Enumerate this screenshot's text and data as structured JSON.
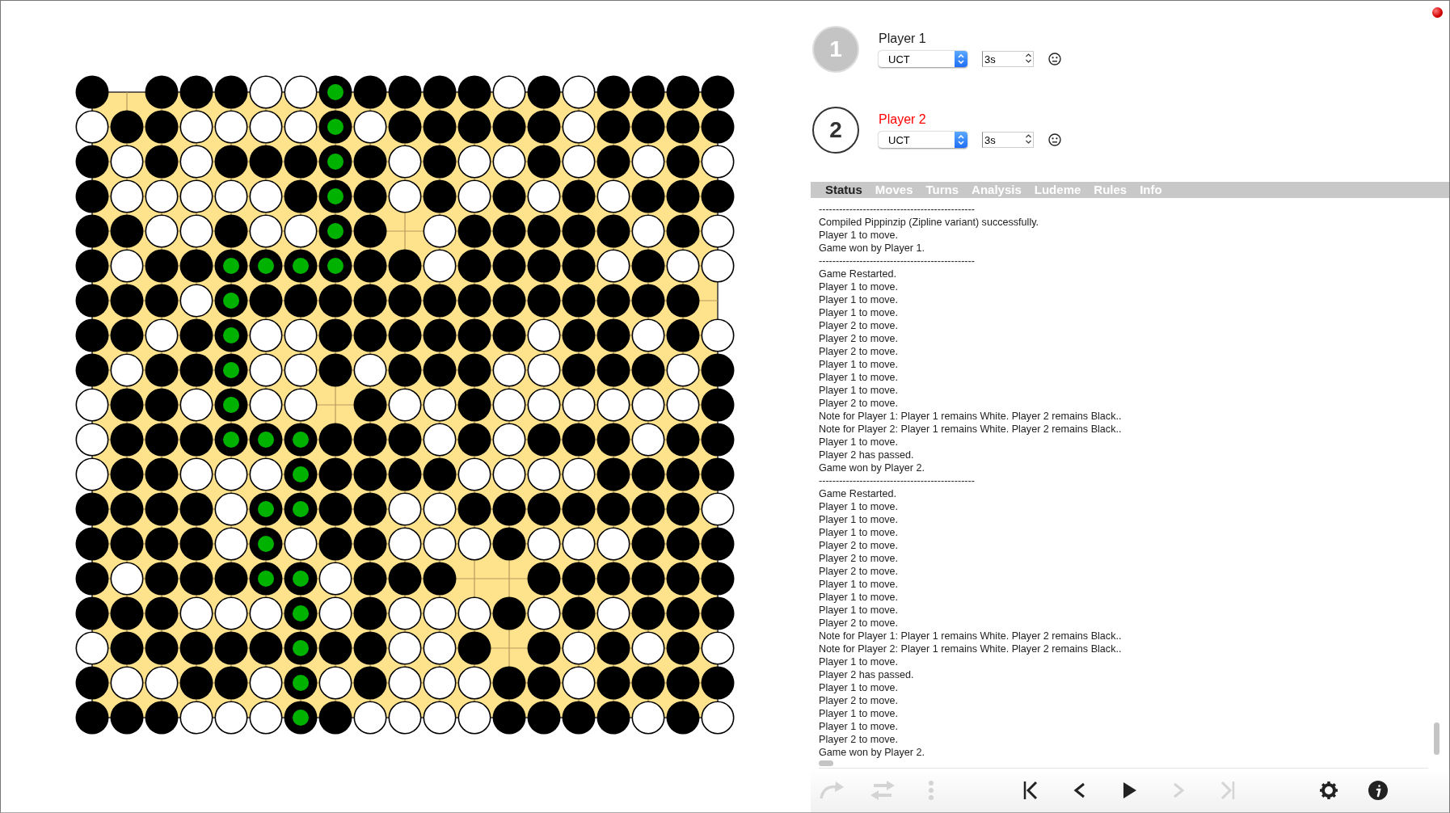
{
  "board": {
    "rows": [
      [
        {
          "kind": "black"
        },
        {
          "kind": "empty"
        },
        {
          "kind": "black"
        },
        {
          "kind": "black"
        },
        {
          "kind": "black"
        },
        {
          "kind": "white"
        },
        {
          "kind": "white"
        },
        {
          "kind": "marked"
        },
        {
          "kind": "black"
        },
        {
          "kind": "black"
        },
        {
          "kind": "black"
        },
        {
          "kind": "black"
        },
        {
          "kind": "white"
        },
        {
          "kind": "black"
        },
        {
          "kind": "white"
        },
        {
          "kind": "black"
        },
        {
          "kind": "black"
        },
        {
          "kind": "black"
        },
        {
          "kind": "black"
        }
      ],
      [
        {
          "kind": "white"
        },
        {
          "kind": "black"
        },
        {
          "kind": "black"
        },
        {
          "kind": "white"
        },
        {
          "kind": "white"
        },
        {
          "kind": "white"
        },
        {
          "kind": "white"
        },
        {
          "kind": "marked"
        },
        {
          "kind": "white"
        },
        {
          "kind": "black"
        },
        {
          "kind": "black"
        },
        {
          "kind": "black"
        },
        {
          "kind": "black"
        },
        {
          "kind": "black"
        },
        {
          "kind": "white"
        },
        {
          "kind": "black"
        },
        {
          "kind": "black"
        },
        {
          "kind": "black"
        },
        {
          "kind": "black"
        }
      ],
      [
        {
          "kind": "black"
        },
        {
          "kind": "white"
        },
        {
          "kind": "black"
        },
        {
          "kind": "white"
        },
        {
          "kind": "black"
        },
        {
          "kind": "black"
        },
        {
          "kind": "black"
        },
        {
          "kind": "marked"
        },
        {
          "kind": "black"
        },
        {
          "kind": "white"
        },
        {
          "kind": "black"
        },
        {
          "kind": "white"
        },
        {
          "kind": "white"
        },
        {
          "kind": "black"
        },
        {
          "kind": "white"
        },
        {
          "kind": "black"
        },
        {
          "kind": "white"
        },
        {
          "kind": "black"
        },
        {
          "kind": "white"
        }
      ],
      [
        {
          "kind": "black"
        },
        {
          "kind": "white"
        },
        {
          "kind": "white"
        },
        {
          "kind": "white"
        },
        {
          "kind": "white"
        },
        {
          "kind": "white"
        },
        {
          "kind": "black"
        },
        {
          "kind": "marked"
        },
        {
          "kind": "black"
        },
        {
          "kind": "white"
        },
        {
          "kind": "black"
        },
        {
          "kind": "white"
        },
        {
          "kind": "black"
        },
        {
          "kind": "white"
        },
        {
          "kind": "black"
        },
        {
          "kind": "white"
        },
        {
          "kind": "black"
        },
        {
          "kind": "black"
        },
        {
          "kind": "black"
        }
      ],
      [
        {
          "kind": "black"
        },
        {
          "kind": "black"
        },
        {
          "kind": "white"
        },
        {
          "kind": "white"
        },
        {
          "kind": "black"
        },
        {
          "kind": "white"
        },
        {
          "kind": "white"
        },
        {
          "kind": "marked"
        },
        {
          "kind": "black"
        },
        {
          "kind": "empty"
        },
        {
          "kind": "white"
        },
        {
          "kind": "black"
        },
        {
          "kind": "black"
        },
        {
          "kind": "black"
        },
        {
          "kind": "black"
        },
        {
          "kind": "black"
        },
        {
          "kind": "white"
        },
        {
          "kind": "black"
        },
        {
          "kind": "white"
        }
      ],
      [
        {
          "kind": "black"
        },
        {
          "kind": "white"
        },
        {
          "kind": "black"
        },
        {
          "kind": "black"
        },
        {
          "kind": "marked"
        },
        {
          "kind": "marked"
        },
        {
          "kind": "marked"
        },
        {
          "kind": "marked"
        },
        {
          "kind": "black"
        },
        {
          "kind": "black"
        },
        {
          "kind": "white"
        },
        {
          "kind": "black"
        },
        {
          "kind": "black"
        },
        {
          "kind": "black"
        },
        {
          "kind": "black"
        },
        {
          "kind": "white"
        },
        {
          "kind": "black"
        },
        {
          "kind": "white"
        },
        {
          "kind": "white"
        }
      ],
      [
        {
          "kind": "black"
        },
        {
          "kind": "black"
        },
        {
          "kind": "black"
        },
        {
          "kind": "white"
        },
        {
          "kind": "marked"
        },
        {
          "kind": "black"
        },
        {
          "kind": "black"
        },
        {
          "kind": "black"
        },
        {
          "kind": "black"
        },
        {
          "kind": "black"
        },
        {
          "kind": "black"
        },
        {
          "kind": "black"
        },
        {
          "kind": "black"
        },
        {
          "kind": "black"
        },
        {
          "kind": "black"
        },
        {
          "kind": "black"
        },
        {
          "kind": "black"
        },
        {
          "kind": "black"
        },
        {
          "kind": "empty"
        }
      ],
      [
        {
          "kind": "black"
        },
        {
          "kind": "black"
        },
        {
          "kind": "white"
        },
        {
          "kind": "black"
        },
        {
          "kind": "marked"
        },
        {
          "kind": "white"
        },
        {
          "kind": "white"
        },
        {
          "kind": "black"
        },
        {
          "kind": "black"
        },
        {
          "kind": "black"
        },
        {
          "kind": "black"
        },
        {
          "kind": "black"
        },
        {
          "kind": "black"
        },
        {
          "kind": "white"
        },
        {
          "kind": "black"
        },
        {
          "kind": "black"
        },
        {
          "kind": "white"
        },
        {
          "kind": "black"
        },
        {
          "kind": "white"
        }
      ],
      [
        {
          "kind": "black"
        },
        {
          "kind": "white"
        },
        {
          "kind": "black"
        },
        {
          "kind": "black"
        },
        {
          "kind": "marked"
        },
        {
          "kind": "white"
        },
        {
          "kind": "white"
        },
        {
          "kind": "black"
        },
        {
          "kind": "white"
        },
        {
          "kind": "black"
        },
        {
          "kind": "black"
        },
        {
          "kind": "black"
        },
        {
          "kind": "white"
        },
        {
          "kind": "white"
        },
        {
          "kind": "black"
        },
        {
          "kind": "black"
        },
        {
          "kind": "black"
        },
        {
          "kind": "white"
        },
        {
          "kind": "black"
        }
      ],
      [
        {
          "kind": "white"
        },
        {
          "kind": "black"
        },
        {
          "kind": "black"
        },
        {
          "kind": "white"
        },
        {
          "kind": "marked"
        },
        {
          "kind": "white"
        },
        {
          "kind": "white"
        },
        {
          "kind": "empty"
        },
        {
          "kind": "black"
        },
        {
          "kind": "white"
        },
        {
          "kind": "white"
        },
        {
          "kind": "black"
        },
        {
          "kind": "white"
        },
        {
          "kind": "white"
        },
        {
          "kind": "white"
        },
        {
          "kind": "white"
        },
        {
          "kind": "white"
        },
        {
          "kind": "white"
        },
        {
          "kind": "black"
        }
      ],
      [
        {
          "kind": "white"
        },
        {
          "kind": "black"
        },
        {
          "kind": "black"
        },
        {
          "kind": "black"
        },
        {
          "kind": "marked"
        },
        {
          "kind": "marked"
        },
        {
          "kind": "marked"
        },
        {
          "kind": "black"
        },
        {
          "kind": "black"
        },
        {
          "kind": "black"
        },
        {
          "kind": "white"
        },
        {
          "kind": "black"
        },
        {
          "kind": "white"
        },
        {
          "kind": "black"
        },
        {
          "kind": "black"
        },
        {
          "kind": "black"
        },
        {
          "kind": "white"
        },
        {
          "kind": "black"
        },
        {
          "kind": "black"
        }
      ],
      [
        {
          "kind": "white"
        },
        {
          "kind": "black"
        },
        {
          "kind": "black"
        },
        {
          "kind": "white"
        },
        {
          "kind": "white"
        },
        {
          "kind": "white"
        },
        {
          "kind": "marked"
        },
        {
          "kind": "black"
        },
        {
          "kind": "black"
        },
        {
          "kind": "black"
        },
        {
          "kind": "black"
        },
        {
          "kind": "white"
        },
        {
          "kind": "white"
        },
        {
          "kind": "white"
        },
        {
          "kind": "white"
        },
        {
          "kind": "black"
        },
        {
          "kind": "black"
        },
        {
          "kind": "black"
        },
        {
          "kind": "black"
        }
      ],
      [
        {
          "kind": "black"
        },
        {
          "kind": "black"
        },
        {
          "kind": "black"
        },
        {
          "kind": "black"
        },
        {
          "kind": "white"
        },
        {
          "kind": "marked"
        },
        {
          "kind": "marked"
        },
        {
          "kind": "black"
        },
        {
          "kind": "black"
        },
        {
          "kind": "white"
        },
        {
          "kind": "white"
        },
        {
          "kind": "black"
        },
        {
          "kind": "black"
        },
        {
          "kind": "black"
        },
        {
          "kind": "black"
        },
        {
          "kind": "black"
        },
        {
          "kind": "black"
        },
        {
          "kind": "black"
        },
        {
          "kind": "white"
        }
      ],
      [
        {
          "kind": "black"
        },
        {
          "kind": "black"
        },
        {
          "kind": "black"
        },
        {
          "kind": "black"
        },
        {
          "kind": "white"
        },
        {
          "kind": "marked"
        },
        {
          "kind": "white"
        },
        {
          "kind": "black"
        },
        {
          "kind": "black"
        },
        {
          "kind": "white"
        },
        {
          "kind": "white"
        },
        {
          "kind": "white"
        },
        {
          "kind": "black"
        },
        {
          "kind": "white"
        },
        {
          "kind": "white"
        },
        {
          "kind": "white"
        },
        {
          "kind": "black"
        },
        {
          "kind": "black"
        },
        {
          "kind": "black"
        }
      ],
      [
        {
          "kind": "black"
        },
        {
          "kind": "white"
        },
        {
          "kind": "black"
        },
        {
          "kind": "black"
        },
        {
          "kind": "black"
        },
        {
          "kind": "marked"
        },
        {
          "kind": "marked"
        },
        {
          "kind": "white"
        },
        {
          "kind": "black"
        },
        {
          "kind": "black"
        },
        {
          "kind": "black"
        },
        {
          "kind": "empty"
        },
        {
          "kind": "empty"
        },
        {
          "kind": "black"
        },
        {
          "kind": "black"
        },
        {
          "kind": "black"
        },
        {
          "kind": "black"
        },
        {
          "kind": "black"
        },
        {
          "kind": "black"
        }
      ],
      [
        {
          "kind": "black"
        },
        {
          "kind": "black"
        },
        {
          "kind": "black"
        },
        {
          "kind": "white"
        },
        {
          "kind": "white"
        },
        {
          "kind": "white"
        },
        {
          "kind": "marked"
        },
        {
          "kind": "white"
        },
        {
          "kind": "black"
        },
        {
          "kind": "white"
        },
        {
          "kind": "white"
        },
        {
          "kind": "white"
        },
        {
          "kind": "black"
        },
        {
          "kind": "white"
        },
        {
          "kind": "black"
        },
        {
          "kind": "white"
        },
        {
          "kind": "black"
        },
        {
          "kind": "black"
        },
        {
          "kind": "black"
        }
      ],
      [
        {
          "kind": "white"
        },
        {
          "kind": "black"
        },
        {
          "kind": "black"
        },
        {
          "kind": "black"
        },
        {
          "kind": "black"
        },
        {
          "kind": "black"
        },
        {
          "kind": "marked"
        },
        {
          "kind": "black"
        },
        {
          "kind": "black"
        },
        {
          "kind": "white"
        },
        {
          "kind": "white"
        },
        {
          "kind": "black"
        },
        {
          "kind": "empty"
        },
        {
          "kind": "black"
        },
        {
          "kind": "white"
        },
        {
          "kind": "black"
        },
        {
          "kind": "white"
        },
        {
          "kind": "black"
        },
        {
          "kind": "white"
        }
      ],
      [
        {
          "kind": "black"
        },
        {
          "kind": "white"
        },
        {
          "kind": "white"
        },
        {
          "kind": "black"
        },
        {
          "kind": "black"
        },
        {
          "kind": "white"
        },
        {
          "kind": "marked"
        },
        {
          "kind": "white"
        },
        {
          "kind": "black"
        },
        {
          "kind": "white"
        },
        {
          "kind": "white"
        },
        {
          "kind": "white"
        },
        {
          "kind": "black"
        },
        {
          "kind": "black"
        },
        {
          "kind": "white"
        },
        {
          "kind": "black"
        },
        {
          "kind": "black"
        },
        {
          "kind": "black"
        },
        {
          "kind": "black"
        }
      ],
      [
        {
          "kind": "black"
        },
        {
          "kind": "black"
        },
        {
          "kind": "black"
        },
        {
          "kind": "white"
        },
        {
          "kind": "white"
        },
        {
          "kind": "white"
        },
        {
          "kind": "marked"
        },
        {
          "kind": "black"
        },
        {
          "kind": "white"
        },
        {
          "kind": "white"
        },
        {
          "kind": "white"
        },
        {
          "kind": "white"
        },
        {
          "kind": "black"
        },
        {
          "kind": "black"
        },
        {
          "kind": "black"
        },
        {
          "kind": "black"
        },
        {
          "kind": "white"
        },
        {
          "kind": "black"
        },
        {
          "kind": "white"
        }
      ]
    ]
  },
  "players": [
    {
      "number": "1",
      "name": "Player 1",
      "active": false,
      "agent": "UCT",
      "time": "3s"
    },
    {
      "number": "2",
      "name": "Player 2",
      "active": true,
      "agent": "UCT",
      "time": "3s"
    }
  ],
  "tabs": [
    {
      "label": "Status",
      "selected": true
    },
    {
      "label": "Moves",
      "selected": false
    },
    {
      "label": "Turns",
      "selected": false
    },
    {
      "label": "Analysis",
      "selected": false
    },
    {
      "label": "Ludeme",
      "selected": false
    },
    {
      "label": "Rules",
      "selected": false
    },
    {
      "label": "Info",
      "selected": false
    }
  ],
  "status_log": [
    "----------------------------------------------",
    "Compiled Pippinzip (Zipline variant) successfully.",
    "Player 1 to move.",
    "Game won by Player 1.",
    "----------------------------------------------",
    "Game Restarted.",
    "Player 1 to move.",
    "Player 1 to move.",
    "Player 1 to move.",
    "Player 2 to move.",
    "Player 2 to move.",
    "Player 2 to move.",
    "Player 1 to move.",
    "Player 1 to move.",
    "Player 1 to move.",
    "Player 2 to move.",
    "Note for Player 1: Player 1 remains White. Player 2 remains Black..",
    "Note for Player 2: Player 1 remains White. Player 2 remains Black..",
    "Player 1 to move.",
    "Player 2 has passed.",
    "Game won by Player 2.",
    "----------------------------------------------",
    "Game Restarted.",
    "Player 1 to move.",
    "Player 1 to move.",
    "Player 1 to move.",
    "Player 2 to move.",
    "Player 2 to move.",
    "Player 2 to move.",
    "Player 1 to move.",
    "Player 1 to move.",
    "Player 1 to move.",
    "Player 2 to move.",
    "Note for Player 1: Player 1 remains White. Player 2 remains Black..",
    "Note for Player 2: Player 1 remains White. Player 2 remains Black..",
    "Player 1 to move.",
    "Player 2 has passed.",
    "Player 1 to move.",
    "Player 2 to move.",
    "Player 1 to move.",
    "Player 1 to move.",
    "Player 2 to move.",
    "Game won by Player 2."
  ],
  "toolbar": [
    {
      "kind": "redo",
      "disabled": true
    },
    {
      "kind": "swap",
      "disabled": true
    },
    {
      "kind": "more",
      "disabled": true
    },
    {
      "kind": "first",
      "disabled": false
    },
    {
      "kind": "prev",
      "disabled": false
    },
    {
      "kind": "play",
      "disabled": false
    },
    {
      "kind": "next",
      "disabled": true
    },
    {
      "kind": "last",
      "disabled": true
    },
    {
      "kind": "settings",
      "disabled": false
    },
    {
      "kind": "info",
      "disabled": false
    }
  ]
}
